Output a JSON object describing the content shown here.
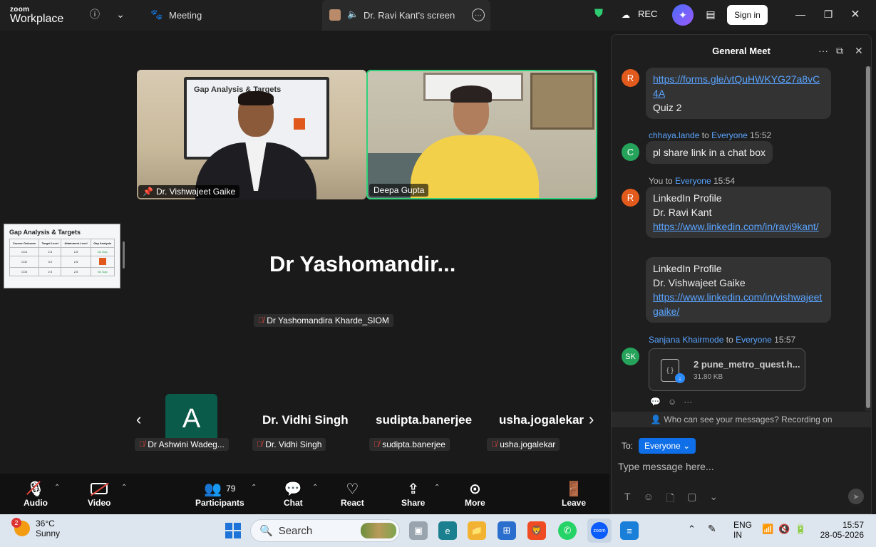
{
  "topbar": {
    "logo_line1": "zoom",
    "logo_line2": "Workplace",
    "meeting_label": "Meeting",
    "screen_tab_label": "Dr. Ravi Kant's screen",
    "rec_label": "REC",
    "signin_label": "Sign in"
  },
  "stage": {
    "tile1_name": "Dr. Vishwajeet Gaike",
    "tile1_slide_title": "Gap Analysis & Targets",
    "tile2_name": "Deepa Gupta",
    "shared_thumb": {
      "title": "Gap Analysis & Targets",
      "headers": [
        "Course Outcome",
        "Target Level",
        "Attainment Level",
        "Gap Analysis"
      ],
      "rows": [
        [
          "CO1",
          "2.5",
          "2.5",
          "No Gap"
        ],
        [
          "CO2",
          "3.0",
          "2.5",
          ""
        ],
        [
          "CO3",
          "2.5",
          "2.5",
          "No Gap"
        ]
      ]
    },
    "speaker_big_name": "Dr  Yashomandir...",
    "speaker_tag": "Dr Yashomandira Kharde_SIOM",
    "strip": [
      {
        "avatar_letter": "A",
        "tag": "Dr Ashwini Wadeg..."
      },
      {
        "name": "Dr. Vidhi Singh",
        "tag": "Dr. Vidhi Singh"
      },
      {
        "name": "sudipta.banerjee",
        "tag": "sudipta.banerjee"
      },
      {
        "name": "usha.jogalekar",
        "tag": "usha.jogalekar"
      }
    ]
  },
  "toolbar": {
    "audio": "Audio",
    "video": "Video",
    "participants": "Participants",
    "participants_count": "79",
    "chat": "Chat",
    "react": "React",
    "share": "Share",
    "more": "More",
    "leave": "Leave"
  },
  "chat": {
    "title": "General Meet",
    "messages": {
      "m1_avatar": "R",
      "m1_link": "https://forms.gle/vtQuHWKYG27a8vC4A",
      "m1_text": "Quiz 2",
      "m2_sender": "chhaya.lande",
      "m2_to": "to",
      "m2_recipient": "Everyone",
      "m2_time": "15:52",
      "m2_avatar": "C",
      "m2_text": "pl share link in a chat box",
      "m3_sender": "You to",
      "m3_recipient": "Everyone",
      "m3_time": "15:54",
      "m3_avatar": "R",
      "m3_line1": "LinkedIn Profile",
      "m3_line2": "Dr. Ravi Kant",
      "m3_link": "https://www.linkedin.com/in/ravi9kant/",
      "m4_line1": "LinkedIn Profile",
      "m4_line2": "Dr. Vishwajeet Gaike",
      "m4_link": "https://www.linkedin.com/in/vishwajeetgaike/",
      "m5_sender": "Sanjana Khairmode",
      "m5_to": "to",
      "m5_recipient": "Everyone",
      "m5_time": "15:57",
      "m5_avatar": "SK",
      "m5_file_name": "2 pune_metro_quest.h...",
      "m5_file_size": "31.80 KB"
    },
    "visibility_note": "Who can see your messages? Recording on",
    "to_label": "To:",
    "to_value": "Everyone",
    "input_placeholder": "Type message here..."
  },
  "taskbar": {
    "weather_badge": "2",
    "temperature": "36°C",
    "condition": "Sunny",
    "search_label": "Search",
    "lang_line1": "ENG",
    "lang_line2": "IN",
    "time": "15:57",
    "date": "28-05-2026"
  }
}
